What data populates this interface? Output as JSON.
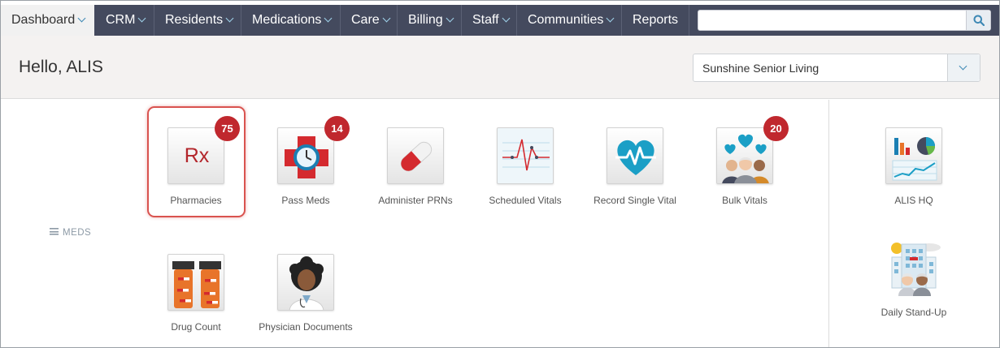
{
  "nav": {
    "items": [
      {
        "label": "Dashboard",
        "has_menu": true,
        "active": true
      },
      {
        "label": "CRM",
        "has_menu": true
      },
      {
        "label": "Residents",
        "has_menu": true
      },
      {
        "label": "Medications",
        "has_menu": true
      },
      {
        "label": "Care",
        "has_menu": true
      },
      {
        "label": "Billing",
        "has_menu": true
      },
      {
        "label": "Staff",
        "has_menu": true
      },
      {
        "label": "Communities",
        "has_menu": true
      },
      {
        "label": "Reports",
        "has_menu": false
      }
    ],
    "search": {
      "value": "",
      "placeholder": "",
      "icon": "search-icon"
    },
    "colors": {
      "bar": "#444a5e",
      "active_tab": "#f1f1f1",
      "chevron": "#9fd3ec"
    }
  },
  "header": {
    "greeting": "Hello, ALIS",
    "community_select": {
      "selected": "Sunshine Senior Living",
      "icon": "chevron-down-icon"
    }
  },
  "meds_section": {
    "label": "MEDS",
    "icon": "hamburger-icon",
    "tiles": [
      {
        "label": "Pharmacies",
        "badge": "75",
        "icon": "rx-icon",
        "highlighted": true
      },
      {
        "label": "Pass Meds",
        "badge": "14",
        "icon": "medical-cross-clock-icon"
      },
      {
        "label": "Administer PRNs",
        "icon": "pill-capsule-icon"
      },
      {
        "label": "Scheduled Vitals",
        "icon": "ecg-chart-icon"
      },
      {
        "label": "Record Single Vital",
        "icon": "heartbeat-icon"
      },
      {
        "label": "Bulk Vitals",
        "badge": "20",
        "icon": "group-heartbeat-icon"
      },
      {
        "label": "Drug Count",
        "icon": "pill-bottles-icon"
      },
      {
        "label": "Physician Documents",
        "icon": "physician-icon"
      }
    ]
  },
  "side_section": {
    "tiles": [
      {
        "label": "ALIS HQ",
        "icon": "analytics-charts-icon"
      },
      {
        "label": "Daily Stand-Up",
        "icon": "building-residents-icon"
      }
    ]
  },
  "colors": {
    "badge": "#c0282e",
    "highlight": "#d9534f",
    "accent": "#3d88b4",
    "heart": "#1b9fc6"
  }
}
